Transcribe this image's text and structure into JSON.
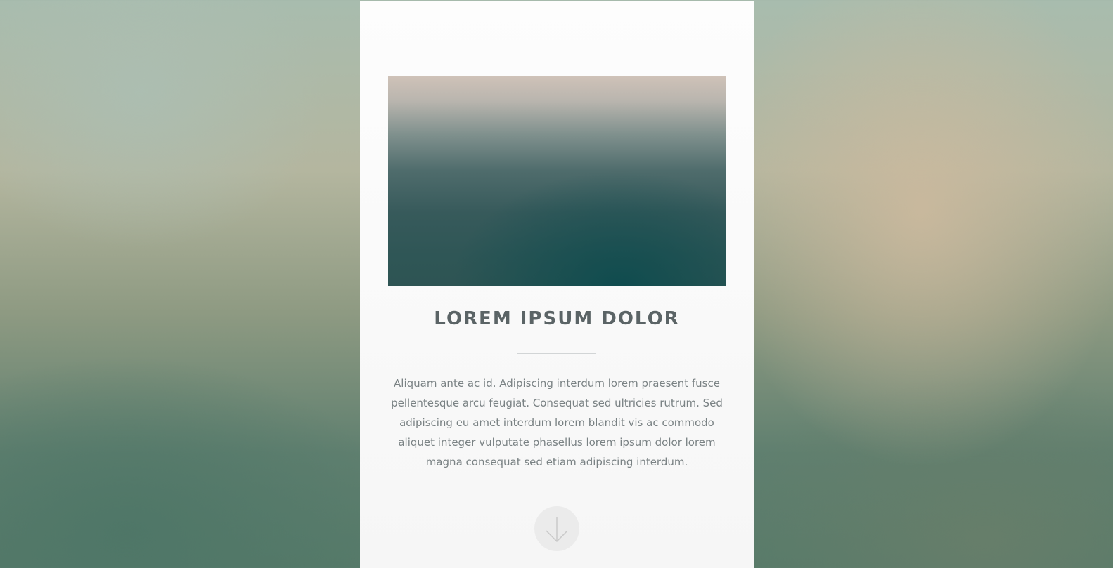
{
  "card": {
    "title": "LOREM IPSUM DOLOR",
    "body": "Aliquam ante ac id. Adipiscing interdum lorem praesent fusce pellentesque arcu feugiat. Consequat sed ultricies rutrum. Sed adipiscing eu amet interdum lorem blandit vis ac commodo aliquet integer vulputate phasellus lorem ipsum dolor lorem magna consequat sed etiam adipiscing interdum."
  },
  "scroll_button": {
    "icon": "arrow-down-icon"
  },
  "colors": {
    "title": "#5b6466",
    "text": "#7a8284",
    "card_background": "#fafafa",
    "button_background": "#ebebeb"
  }
}
